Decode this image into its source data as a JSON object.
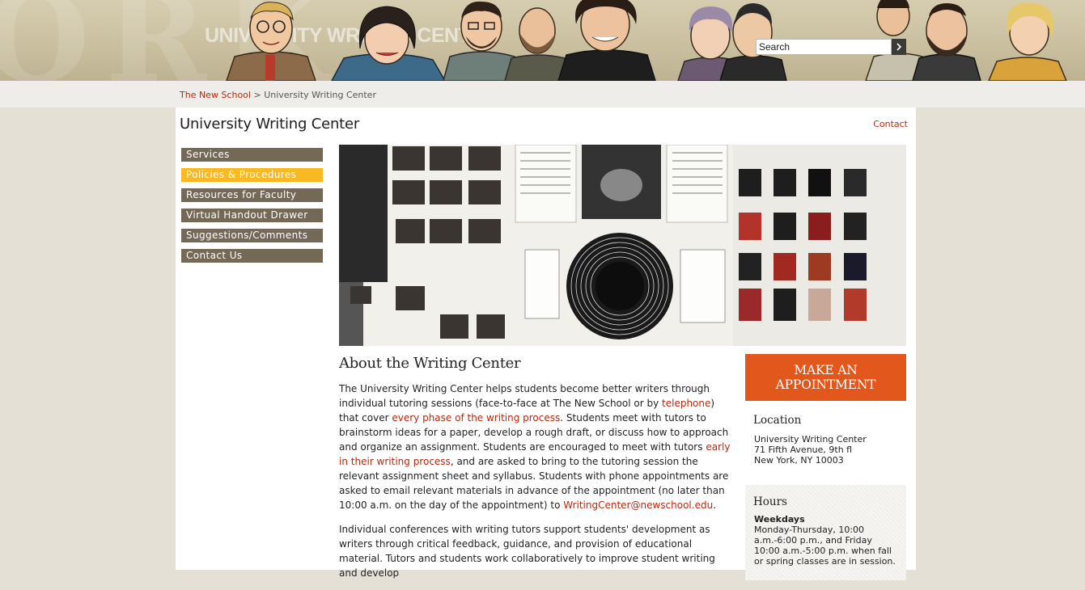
{
  "banner": {
    "title": "UNIVERSITY WRITING CENTER",
    "search": {
      "placeholder": "Search",
      "value": "Search"
    }
  },
  "breadcrumb": {
    "home": "The New School",
    "separator": ">",
    "current": "University Writing Center"
  },
  "page": {
    "title": "University Writing Center",
    "contact_link": "Contact"
  },
  "nav": {
    "items": [
      {
        "label": "Services",
        "active": false
      },
      {
        "label": "Policies & Procedures",
        "active": true
      },
      {
        "label": "Resources for Faculty",
        "active": false
      },
      {
        "label": "Virtual Handout Drawer",
        "active": false
      },
      {
        "label": "Suggestions/Comments",
        "active": false
      },
      {
        "label": "Contact Us",
        "active": false
      }
    ]
  },
  "content": {
    "heading": "About the Writing Center",
    "p1": {
      "t1": "The University Writing Center helps students become better writers through individual tutoring sessions (face-to-face at The New School or by ",
      "link1": "telephone",
      "t2": ") that cover ",
      "link2": "every phase of the writing process",
      "t3": ". Students meet with tutors to brainstorm ideas for a paper, develop a rough draft, or discuss how to approach and organize an assignment. Students are encouraged to meet with tutors ",
      "link3": "early in their writing process",
      "t4": ", and are asked to bring to the tutoring session the relevant assignment sheet and syllabus. Students with phone appointments are asked to email relevant materials in advance of the appointment (no later than 10:00 a.m. on the day of the appointment) to ",
      "link4": "WritingCenter@newschool.edu",
      "t5": "."
    },
    "p2": "Individual conferences with writing tutors support students' development as writers through critical feedback, guidance, and provision of educational material. Tutors and students work collaboratively to improve student writing and develop"
  },
  "sidebar": {
    "appointment_line1": "MAKE AN",
    "appointment_line2": "APPOINTMENT",
    "location": {
      "heading": "Location",
      "line1": "University Writing Center",
      "line2": "71 Fifth Avenue, 9th fl",
      "line3": "New York, NY 10003"
    },
    "hours": {
      "heading": "Hours",
      "label": "Weekdays",
      "text": "Monday-Thursday, 10:00 a.m.-6:00 p.m., and Friday 10:00 a.m.-5:00 p.m. when fall or spring classes are in session."
    }
  },
  "colors": {
    "accent_link": "#b52a10",
    "nav_bg": "#746957",
    "nav_active": "#f9b922",
    "appointment_bg": "#e2571b"
  }
}
